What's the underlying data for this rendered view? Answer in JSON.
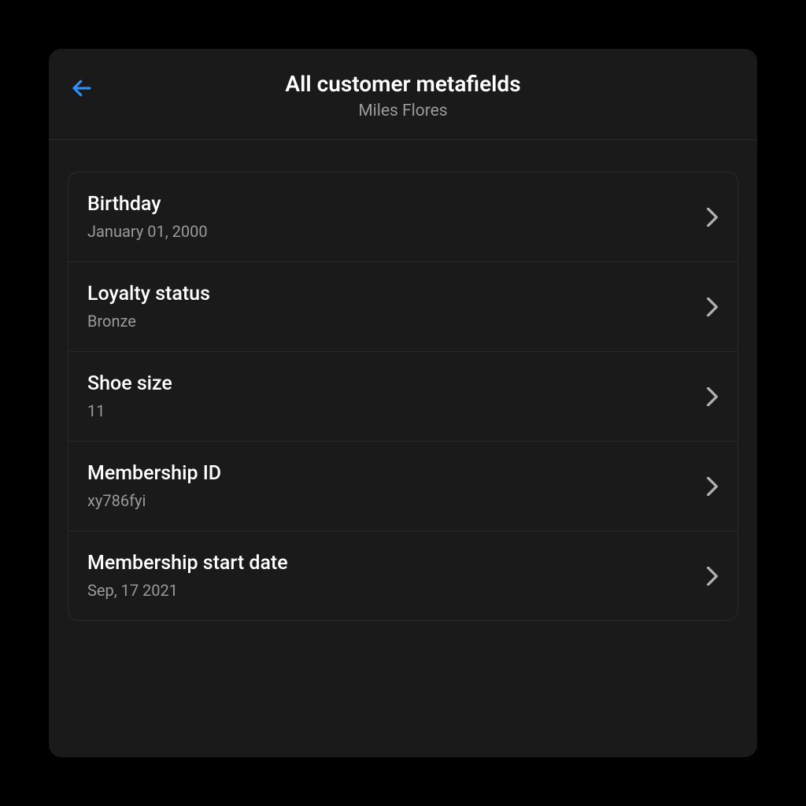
{
  "header": {
    "title": "All customer metafields",
    "subtitle": "Miles Flores"
  },
  "metafields": [
    {
      "label": "Birthday",
      "value": "January 01, 2000"
    },
    {
      "label": "Loyalty status",
      "value": "Bronze"
    },
    {
      "label": "Shoe size",
      "value": "11"
    },
    {
      "label": "Membership ID",
      "value": "xy786fyi"
    },
    {
      "label": "Membership start date",
      "value": "Sep, 17 2021"
    }
  ],
  "colors": {
    "accent": "#2e90fa",
    "background": "#1a1a1a",
    "border": "#2a2a2a",
    "textPrimary": "#ffffff",
    "textSecondary": "#9a9a9a",
    "chevron": "#b0b0b0"
  }
}
